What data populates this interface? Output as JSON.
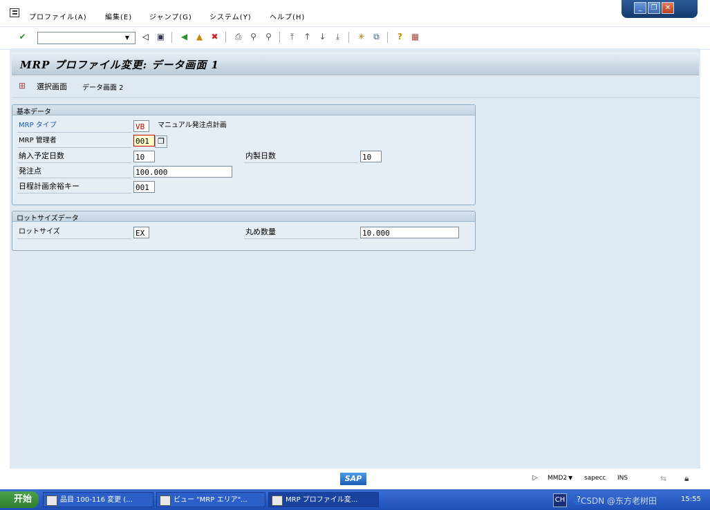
{
  "menubar": {
    "items": [
      "プロファイル(A)",
      "編集(E)",
      "ジャンプ(G)",
      "システム(Y)",
      "ヘルプ(H)"
    ]
  },
  "toolbar": {
    "command_field_value": ""
  },
  "screen": {
    "title": "MRP プロファイル変更: データ画面 1",
    "app_buttons": [
      "選択画面",
      "データ画面 2"
    ]
  },
  "basic_data": {
    "group_title": "基本データ",
    "mrp_type_label": "MRP タイプ",
    "mrp_type_value": "VB",
    "mrp_type_desc": "マニュアル発注点計画",
    "mrp_controller_label": "MRP 管理者",
    "mrp_controller_value": "001",
    "planned_delivery_label": "納入予定日数",
    "planned_delivery_value": "10",
    "inhouse_label": "内製日数",
    "inhouse_value": "10",
    "reorder_point_label": "発注点",
    "reorder_point_value": "100.000",
    "schedmargin_label": "日程計画余裕キー",
    "schedmargin_value": "001"
  },
  "lot_data": {
    "group_title": "ロットサイズデータ",
    "lot_size_label": "ロットサイズ",
    "lot_size_value": "EX",
    "rounding_label": "丸め数量",
    "rounding_value": "10.000"
  },
  "statusbar": {
    "system_tcode": "MMD2",
    "server": "sapecc",
    "mode": "INS"
  },
  "taskbar": {
    "start_label": "开始",
    "tasks": [
      "品目 100-116 変更 (...",
      "ビュー \"MRP エリア\"...",
      "MRP プロファイル変..."
    ],
    "tray_lang": "CH",
    "clock": "15:55",
    "watermark": "CSDN @东方老树田"
  },
  "colors": {
    "frame_bg": "#dfe9f1",
    "sap_blue": "#1c5fb5",
    "error_red": "#cc0000",
    "highlight": "#ffffc8"
  }
}
